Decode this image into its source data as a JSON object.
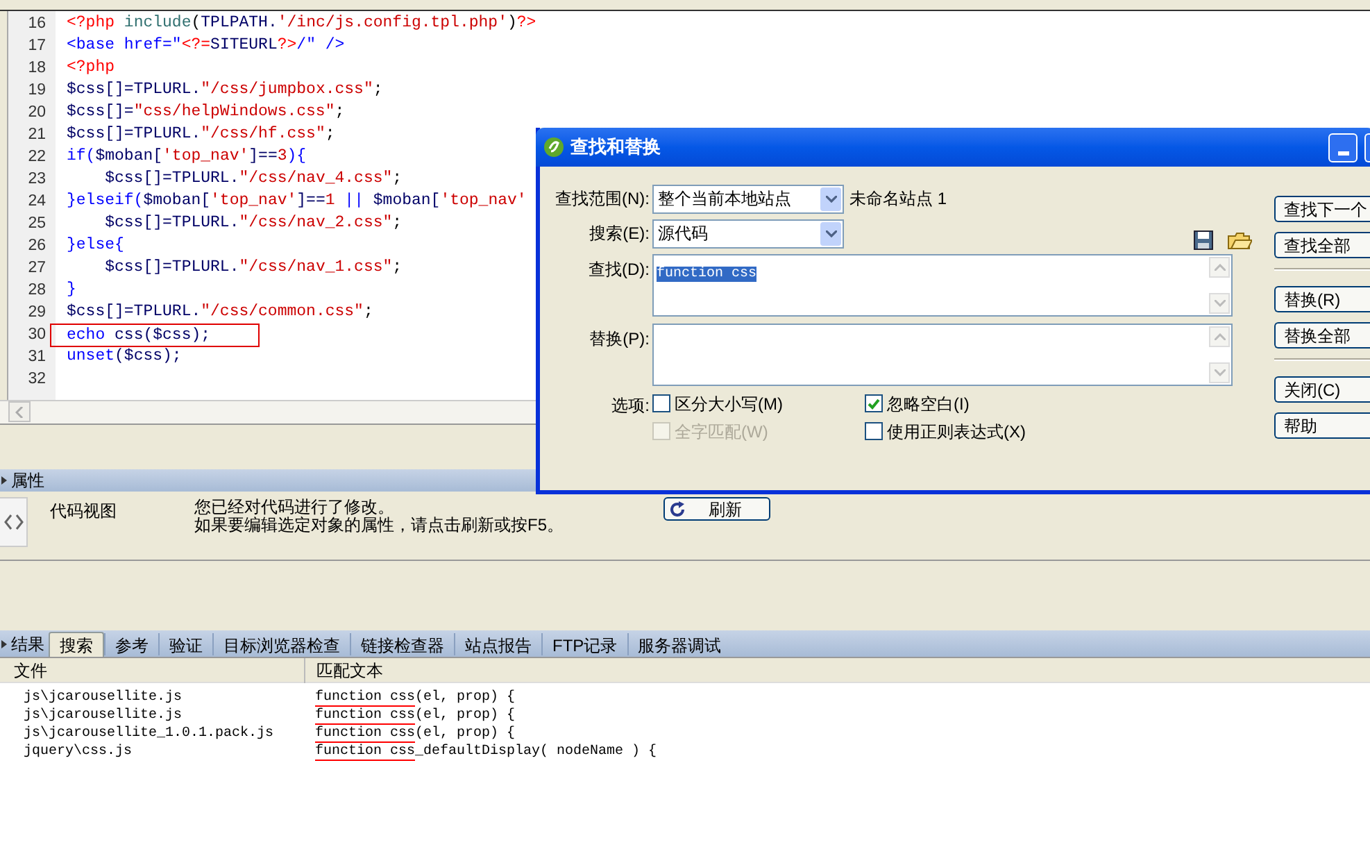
{
  "editor": {
    "lines": [
      {
        "number": "16",
        "segments": [
          {
            "kind": "php",
            "text": "<?php"
          },
          {
            "kind": "fn",
            "text": " include"
          },
          {
            "kind": "punc",
            "text": "("
          },
          {
            "kind": "var",
            "text": "TPLPATH."
          },
          {
            "kind": "str",
            "text": "'/inc/js.config.tpl.php'"
          },
          {
            "kind": "punc",
            "text": ")"
          },
          {
            "kind": "php",
            "text": "?>"
          }
        ],
        "boxed": false
      },
      {
        "number": "17",
        "segments": [
          {
            "kind": "kw",
            "text": "<base href=\""
          },
          {
            "kind": "php",
            "text": "<?="
          },
          {
            "kind": "var",
            "text": "SITEURL"
          },
          {
            "kind": "php",
            "text": "?>"
          },
          {
            "kind": "kw",
            "text": "/\" />"
          }
        ],
        "boxed": false
      },
      {
        "number": "18",
        "segments": [
          {
            "kind": "php",
            "text": "<?php"
          }
        ],
        "boxed": false
      },
      {
        "number": "19",
        "segments": [
          {
            "kind": "var",
            "text": "$css[]=TPLURL."
          },
          {
            "kind": "str",
            "text": "\"/css/jumpbox.css\""
          },
          {
            "kind": "punc",
            "text": ";"
          }
        ],
        "boxed": false
      },
      {
        "number": "20",
        "segments": [
          {
            "kind": "var",
            "text": "$css[]="
          },
          {
            "kind": "str",
            "text": "\"css/helpWindows.css\""
          },
          {
            "kind": "punc",
            "text": ";"
          }
        ],
        "boxed": false
      },
      {
        "number": "21",
        "segments": [
          {
            "kind": "var",
            "text": "$css[]=TPLURL."
          },
          {
            "kind": "str",
            "text": "\"/css/hf.css\""
          },
          {
            "kind": "punc",
            "text": ";"
          }
        ],
        "boxed": false
      },
      {
        "number": "22",
        "segments": [
          {
            "kind": "kw",
            "text": "if("
          },
          {
            "kind": "var",
            "text": "$moban["
          },
          {
            "kind": "str",
            "text": "'top_nav'"
          },
          {
            "kind": "var",
            "text": "]=="
          },
          {
            "kind": "str",
            "text": "3"
          },
          {
            "kind": "kw",
            "text": "){"
          }
        ],
        "boxed": false
      },
      {
        "number": "23",
        "segments": [
          {
            "kind": "var",
            "text": "    $css[]=TPLURL."
          },
          {
            "kind": "str",
            "text": "\"/css/nav_4.css\""
          },
          {
            "kind": "punc",
            "text": ";"
          }
        ],
        "boxed": false
      },
      {
        "number": "24",
        "segments": [
          {
            "kind": "kw",
            "text": "}elseif("
          },
          {
            "kind": "var",
            "text": "$moban["
          },
          {
            "kind": "str",
            "text": "'top_nav'"
          },
          {
            "kind": "var",
            "text": "]=="
          },
          {
            "kind": "str",
            "text": "1"
          },
          {
            "kind": "kw",
            "text": " || "
          },
          {
            "kind": "var",
            "text": "$moban["
          },
          {
            "kind": "str",
            "text": "'top_nav'"
          }
        ],
        "boxed": false
      },
      {
        "number": "25",
        "segments": [
          {
            "kind": "var",
            "text": "    $css[]=TPLURL."
          },
          {
            "kind": "str",
            "text": "\"/css/nav_2.css\""
          },
          {
            "kind": "punc",
            "text": ";"
          }
        ],
        "boxed": false
      },
      {
        "number": "26",
        "segments": [
          {
            "kind": "kw",
            "text": "}else{"
          }
        ],
        "boxed": false
      },
      {
        "number": "27",
        "segments": [
          {
            "kind": "var",
            "text": "    $css[]=TPLURL."
          },
          {
            "kind": "str",
            "text": "\"/css/nav_1.css\""
          },
          {
            "kind": "punc",
            "text": ";"
          }
        ],
        "boxed": false
      },
      {
        "number": "28",
        "segments": [
          {
            "kind": "kw",
            "text": "}"
          }
        ],
        "boxed": false
      },
      {
        "number": "29",
        "segments": [
          {
            "kind": "var",
            "text": "$css[]=TPLURL."
          },
          {
            "kind": "str",
            "text": "\"/css/common.css\""
          },
          {
            "kind": "punc",
            "text": ";"
          }
        ],
        "boxed": false
      },
      {
        "number": "30",
        "segments": [
          {
            "kind": "kw",
            "text": "echo"
          },
          {
            "kind": "var",
            "text": " css($css);"
          }
        ],
        "boxed": true
      },
      {
        "number": "31",
        "segments": [
          {
            "kind": "kw",
            "text": "unset"
          },
          {
            "kind": "var",
            "text": "($css);"
          }
        ],
        "boxed": false
      },
      {
        "number": "32",
        "boxed": false
      }
    ]
  },
  "properties": {
    "title": "属性",
    "view": "代码视图",
    "message": [
      "您已经对代码进行了修改。",
      "如果要编辑选定对象的属性，请点击刷新或按F5。"
    ],
    "refresh_button": "刷新"
  },
  "results": {
    "title": "结果",
    "tabs": [
      {
        "label": "搜索",
        "selected": true
      },
      {
        "label": "参考",
        "selected": false
      },
      {
        "label": "验证",
        "selected": false
      },
      {
        "label": "目标浏览器检查",
        "selected": false
      },
      {
        "label": "链接检查器",
        "selected": false
      },
      {
        "label": "站点报告",
        "selected": false
      },
      {
        "label": "FTP记录",
        "selected": false
      },
      {
        "label": "服务器调试",
        "selected": false
      }
    ],
    "columns": [
      "文件",
      "匹配文本"
    ],
    "rows": [
      {
        "file": "js\\jcarousellite.js",
        "match": "function css",
        "after": "(el, prop) {"
      },
      {
        "file": "js\\jcarousellite.js",
        "match": "function css",
        "after": "(el, prop) {"
      },
      {
        "file": "js\\jcarousellite_1.0.1.pack.js",
        "match": "function css",
        "after": "(el, prop) {"
      },
      {
        "file": "jquery\\css.js",
        "match": "function css",
        "after": "_defaultDisplay( nodeName ) {"
      }
    ]
  },
  "dialog": {
    "title": "查找和替换",
    "scope": {
      "label": "查找范围(N):",
      "value": "整个当前本地站点",
      "site": "未命名站点 1"
    },
    "search": {
      "label": "搜索(E):",
      "value": "源代码"
    },
    "find": {
      "label": "查找(D):",
      "value": "function css"
    },
    "replace": {
      "label": "替换(P):"
    },
    "options_label": "选项:",
    "options": [
      {
        "label": "区分大小写(M)",
        "checked": false,
        "disabled": false
      },
      {
        "label": "忽略空白(I)",
        "checked": true,
        "disabled": false
      },
      {
        "label": "全字匹配(W)",
        "checked": false,
        "disabled": true
      },
      {
        "label": "使用正则表达式(X)",
        "checked": false,
        "disabled": false
      }
    ],
    "button_groups": [
      [
        "查找下一个",
        "查找全部"
      ],
      [
        "替换(R)",
        "替换全部"
      ],
      [
        "关闭(C)",
        "帮助"
      ]
    ]
  }
}
